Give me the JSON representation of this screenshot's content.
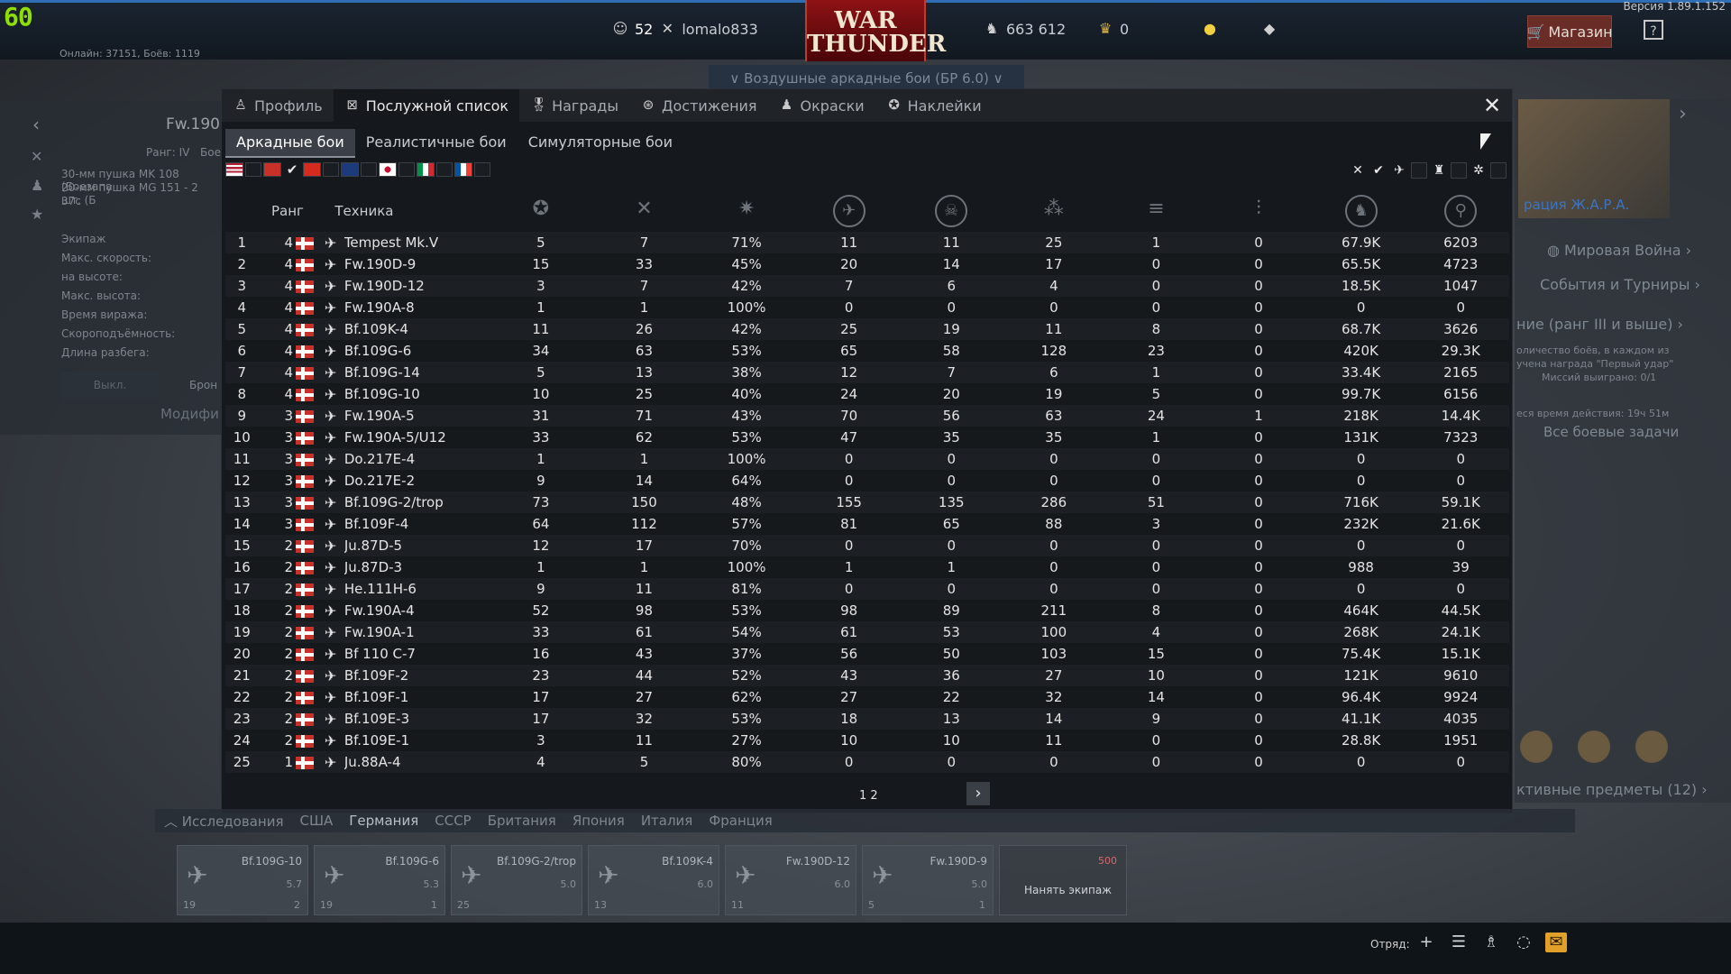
{
  "hud": {
    "fps": "60",
    "version": "Версия 1.89.1.152",
    "online": "Онлайн: 37151, Боёв: 1119"
  },
  "topbar": {
    "rank": "52",
    "username": "lomalo833",
    "logo_line1": "WAR",
    "logo_line2": "THUNDER",
    "silver_lions": "663 612",
    "golden_eagles": "0",
    "shop": "Магазин",
    "help": "?"
  },
  "mode_select": "Воздушные аркадные бои (БР 6.0)",
  "left_panel": {
    "title": "Fw.190",
    "rank": "Ранг: IV",
    "battle": "Бое",
    "lines": [
      "30-мм пушка MK 108 (Боезапа",
      "20-мм пушка MG 151 - 2 шт. (Б",
      "37с",
      "Экипаж",
      "Макс. скорость:",
      "на высоте:",
      "Макс. высота:",
      "Время виража:",
      "Скороподъёмность:",
      "Длина разбега:"
    ],
    "btn_off": "Выкл.",
    "btn_armor": "Брон",
    "modif": "Модифи"
  },
  "right_panel": {
    "event": "рация Ж.А.Р.А.",
    "world_war": "Мировая Война",
    "events": "События и Турниры",
    "task": "ние (ранг III и выше)",
    "task_desc1": "оличество боёв, в каждом из",
    "task_desc2": "учена награда \"Первый удар\"",
    "missions": "Миссий выиграно: 0/1",
    "time_left": "еся время действия: 19ч 51м",
    "all_tasks": "Все боевые задачи",
    "items": "ктивные предметы (12)"
  },
  "modal": {
    "tabs": [
      {
        "label": "Профиль",
        "icon": "profile-icon"
      },
      {
        "label": "Послужной список",
        "icon": "service-record-icon"
      },
      {
        "label": "Награды",
        "icon": "medal-icon"
      },
      {
        "label": "Достижения",
        "icon": "achievements-icon"
      },
      {
        "label": "Окраски",
        "icon": "camouflage-icon"
      },
      {
        "label": "Наклейки",
        "icon": "decal-icon"
      }
    ],
    "subtabs": [
      "Аркадные бои",
      "Реалистичные бои",
      "Симуляторные бои"
    ],
    "columns": {
      "rank": "Ранг",
      "vehicle": "Техника"
    },
    "pages": "1 2",
    "rows": [
      [
        "1",
        "4",
        "Tempest Mk.V",
        "5",
        "7",
        "71%",
        "11",
        "11",
        "25",
        "1",
        "0",
        "67.9K",
        "6203"
      ],
      [
        "2",
        "4",
        "Fw.190D-9",
        "15",
        "33",
        "45%",
        "20",
        "14",
        "17",
        "0",
        "0",
        "65.5K",
        "4723"
      ],
      [
        "3",
        "4",
        "Fw.190D-12",
        "3",
        "7",
        "42%",
        "7",
        "6",
        "4",
        "0",
        "0",
        "18.5K",
        "1047"
      ],
      [
        "4",
        "4",
        "Fw.190A-8",
        "1",
        "1",
        "100%",
        "0",
        "0",
        "0",
        "0",
        "0",
        "0",
        "0"
      ],
      [
        "5",
        "4",
        "Bf.109K-4",
        "11",
        "26",
        "42%",
        "25",
        "19",
        "11",
        "8",
        "0",
        "68.7K",
        "3626"
      ],
      [
        "6",
        "4",
        "Bf.109G-6",
        "34",
        "63",
        "53%",
        "65",
        "58",
        "128",
        "23",
        "0",
        "420K",
        "29.3K"
      ],
      [
        "7",
        "4",
        "Bf.109G-14",
        "5",
        "13",
        "38%",
        "12",
        "7",
        "6",
        "1",
        "0",
        "33.4K",
        "2165"
      ],
      [
        "8",
        "4",
        "Bf.109G-10",
        "10",
        "25",
        "40%",
        "24",
        "20",
        "19",
        "5",
        "0",
        "99.7K",
        "6156"
      ],
      [
        "9",
        "3",
        "Fw.190A-5",
        "31",
        "71",
        "43%",
        "70",
        "56",
        "63",
        "24",
        "1",
        "218K",
        "14.4K"
      ],
      [
        "10",
        "3",
        "Fw.190A-5/U12",
        "33",
        "62",
        "53%",
        "47",
        "35",
        "35",
        "1",
        "0",
        "131K",
        "7323"
      ],
      [
        "11",
        "3",
        "Do.217E-4",
        "1",
        "1",
        "100%",
        "0",
        "0",
        "0",
        "0",
        "0",
        "0",
        "0"
      ],
      [
        "12",
        "3",
        "Do.217E-2",
        "9",
        "14",
        "64%",
        "0",
        "0",
        "0",
        "0",
        "0",
        "0",
        "0"
      ],
      [
        "13",
        "3",
        "Bf.109G-2/trop",
        "73",
        "150",
        "48%",
        "155",
        "135",
        "286",
        "51",
        "0",
        "716K",
        "59.1K"
      ],
      [
        "14",
        "3",
        "Bf.109F-4",
        "64",
        "112",
        "57%",
        "81",
        "65",
        "88",
        "3",
        "0",
        "232K",
        "21.6K"
      ],
      [
        "15",
        "2",
        "Ju.87D-5",
        "12",
        "17",
        "70%",
        "0",
        "0",
        "0",
        "0",
        "0",
        "0",
        "0"
      ],
      [
        "16",
        "2",
        "Ju.87D-3",
        "1",
        "1",
        "100%",
        "1",
        "1",
        "0",
        "0",
        "0",
        "988",
        "39"
      ],
      [
        "17",
        "2",
        "He.111H-6",
        "9",
        "11",
        "81%",
        "0",
        "0",
        "0",
        "0",
        "0",
        "0",
        "0"
      ],
      [
        "18",
        "2",
        "Fw.190A-4",
        "52",
        "98",
        "53%",
        "98",
        "89",
        "211",
        "8",
        "0",
        "464K",
        "44.5K"
      ],
      [
        "19",
        "2",
        "Fw.190A-1",
        "33",
        "61",
        "54%",
        "61",
        "53",
        "100",
        "4",
        "0",
        "268K",
        "24.1K"
      ],
      [
        "20",
        "2",
        "Bf 110 C-7",
        "16",
        "43",
        "37%",
        "56",
        "50",
        "103",
        "15",
        "0",
        "75.4K",
        "15.1K"
      ],
      [
        "21",
        "2",
        "Bf.109F-2",
        "23",
        "44",
        "52%",
        "43",
        "36",
        "27",
        "10",
        "0",
        "121K",
        "9610"
      ],
      [
        "22",
        "2",
        "Bf.109F-1",
        "17",
        "27",
        "62%",
        "27",
        "22",
        "32",
        "14",
        "0",
        "96.4K",
        "9924"
      ],
      [
        "23",
        "2",
        "Bf.109E-3",
        "17",
        "32",
        "53%",
        "18",
        "13",
        "14",
        "9",
        "0",
        "41.1K",
        "4035"
      ],
      [
        "24",
        "2",
        "Bf.109E-1",
        "3",
        "11",
        "27%",
        "10",
        "10",
        "11",
        "0",
        "0",
        "28.8K",
        "1951"
      ],
      [
        "25",
        "1",
        "Ju.88A-4",
        "4",
        "5",
        "80%",
        "0",
        "0",
        "0",
        "0",
        "0",
        "0",
        "0"
      ]
    ]
  },
  "research": {
    "label": "Исследования",
    "nations": [
      "США",
      "Германия",
      "СССР",
      "Британия",
      "Япония",
      "Италия",
      "Франция"
    ]
  },
  "carousel": [
    {
      "name": "Bf.109G-10",
      "br": "5.7",
      "crew": "19",
      "count": "2"
    },
    {
      "name": "Bf.109G-6",
      "br": "5.3",
      "crew": "19",
      "count": "1"
    },
    {
      "name": "Bf.109G-2/trop",
      "br": "5.0",
      "crew": "25",
      "count": ""
    },
    {
      "name": "Bf.109K-4",
      "br": "6.0",
      "crew": "13",
      "count": ""
    },
    {
      "name": "Fw.190D-12",
      "br": "6.0",
      "crew": "11",
      "count": ""
    },
    {
      "name": "Fw.190D-9",
      "br": "5.0",
      "crew": "5",
      "count": "1"
    }
  ],
  "hire": {
    "label": "Нанять экипаж",
    "cost": "500"
  },
  "bottombar": {
    "squad": "Отряд:"
  }
}
